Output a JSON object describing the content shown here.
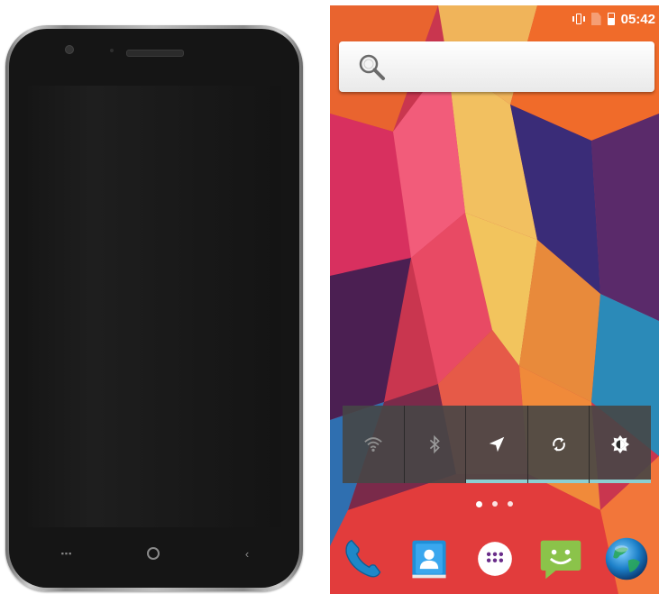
{
  "status_bar": {
    "time": "05:42",
    "icons": [
      "vibrate-icon",
      "no-sim-icon",
      "battery-icon"
    ]
  },
  "search": {
    "icon": "search-icon"
  },
  "quick_settings": {
    "tiles": [
      {
        "name": "wifi",
        "icon": "wifi-icon",
        "enabled": false
      },
      {
        "name": "bluetooth",
        "icon": "bluetooth-icon",
        "enabled": false
      },
      {
        "name": "location",
        "icon": "location-icon",
        "enabled": true
      },
      {
        "name": "sync",
        "icon": "sync-icon",
        "enabled": true
      },
      {
        "name": "brightness",
        "icon": "brightness-icon",
        "enabled": true
      }
    ],
    "indicator_color": "#8ccfd1"
  },
  "home": {
    "pages": 3,
    "current_page": 1
  },
  "dock": {
    "apps": [
      "phone-icon",
      "contacts-icon",
      "app-drawer-icon",
      "messaging-icon",
      "browser-icon"
    ]
  },
  "device": {
    "hardware_keys": [
      "menu-key",
      "home-key",
      "back-key"
    ]
  }
}
